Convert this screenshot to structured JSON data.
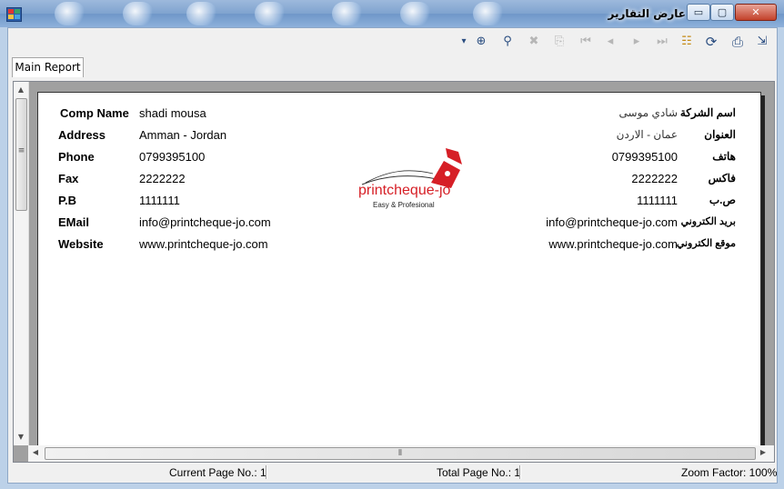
{
  "window": {
    "title": "عارض التقارير",
    "minimize_glyph": "▭",
    "maximize_glyph": "▢",
    "close_glyph": "✕"
  },
  "toolbar": {
    "icons": {
      "dropdown": "▾",
      "find_next": "⊕",
      "find": "⚲",
      "stop": "✖",
      "export_page": "⎘",
      "first": "⏮",
      "prev": "◂",
      "next": "▸",
      "last": "⏭",
      "tree": "☷",
      "refresh": "⟳",
      "print": "⎙",
      "export": "⇲"
    }
  },
  "tabs": [
    {
      "label": "Main Report"
    }
  ],
  "report": {
    "left": [
      {
        "label": "Comp Name",
        "value": "shadi mousa"
      },
      {
        "label": "Address",
        "value": "Amman - Jordan"
      },
      {
        "label": "Phone",
        "value": "0799395100"
      },
      {
        "label": "Fax",
        "value": "2222222"
      },
      {
        "label": "P.B",
        "value": "1111111"
      },
      {
        "label": "EMail",
        "value": "info@printcheque-jo.com"
      },
      {
        "label": "Website",
        "value": "www.printcheque-jo.com"
      }
    ],
    "right": [
      {
        "label": "اسم الشركة",
        "value": "شادي موسى"
      },
      {
        "label": "العنوان",
        "value": "عمان - الاردن"
      },
      {
        "label": "هاتف",
        "value": "0799395100"
      },
      {
        "label": "فاكس",
        "value": "2222222"
      },
      {
        "label": "ص.ب",
        "value": "1111111"
      },
      {
        "label": "بريد الكتروني",
        "value": "info@printcheque-jo.com"
      },
      {
        "label": "موقع الكتروني",
        "value": "www.printcheque-jo.com"
      }
    ],
    "logo": {
      "name": "printcheque-jo",
      "tagline": "Easy & Profesional"
    }
  },
  "status": {
    "current_page": "Current Page No.: 1",
    "total_page": "Total Page No.: 1",
    "zoom": "Zoom Factor: 100%"
  },
  "scroll": {
    "vertical_grip": "≡",
    "horizontal_grip": "⦀",
    "up": "▲",
    "down": "▼",
    "left": "◀",
    "right": "▶"
  },
  "colors": {
    "logo_red": "#d61f26",
    "titlebar": "#7fa3cf"
  }
}
